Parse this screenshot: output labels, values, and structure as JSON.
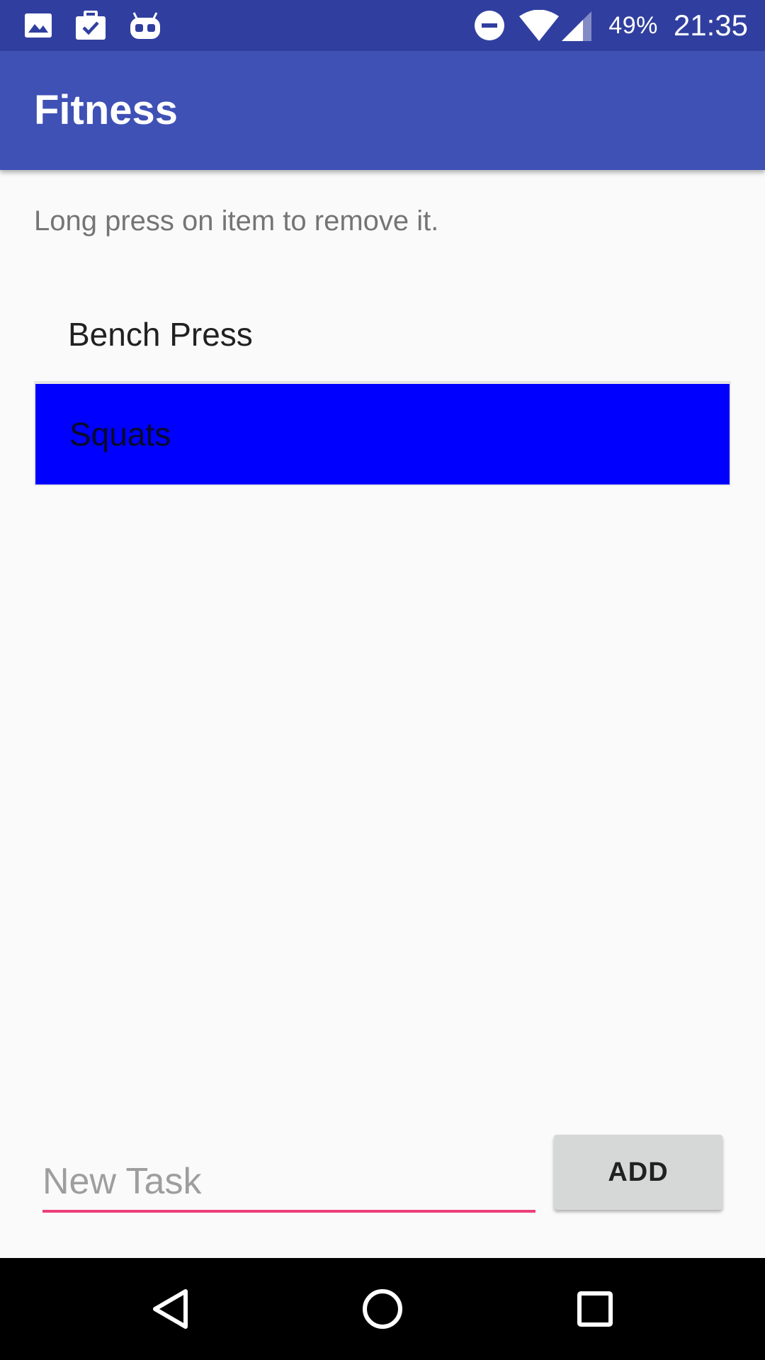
{
  "status_bar": {
    "left_icons": [
      "image-icon",
      "briefcase-check-icon",
      "android-debug-icon"
    ],
    "right_icons": [
      "do-not-disturb-icon",
      "wifi-icon",
      "cell-signal-icon"
    ],
    "battery": "49%",
    "time": "21:35"
  },
  "app_bar": {
    "title": "Fitness"
  },
  "hint": "Long press on item to remove it.",
  "tasks": [
    {
      "label": "Bench Press",
      "selected": false
    },
    {
      "label": "Squats",
      "selected": true
    }
  ],
  "input": {
    "value": "",
    "placeholder": "New Task"
  },
  "add_button_label": "ADD",
  "nav_bar": {
    "icons": [
      "back-icon",
      "home-icon",
      "recents-icon"
    ]
  },
  "colors": {
    "status_bar": "#303f9f",
    "app_bar": "#3f51b5",
    "selected_item": "#0000ff",
    "input_underline": "#ec407a",
    "background": "#fafafa"
  }
}
